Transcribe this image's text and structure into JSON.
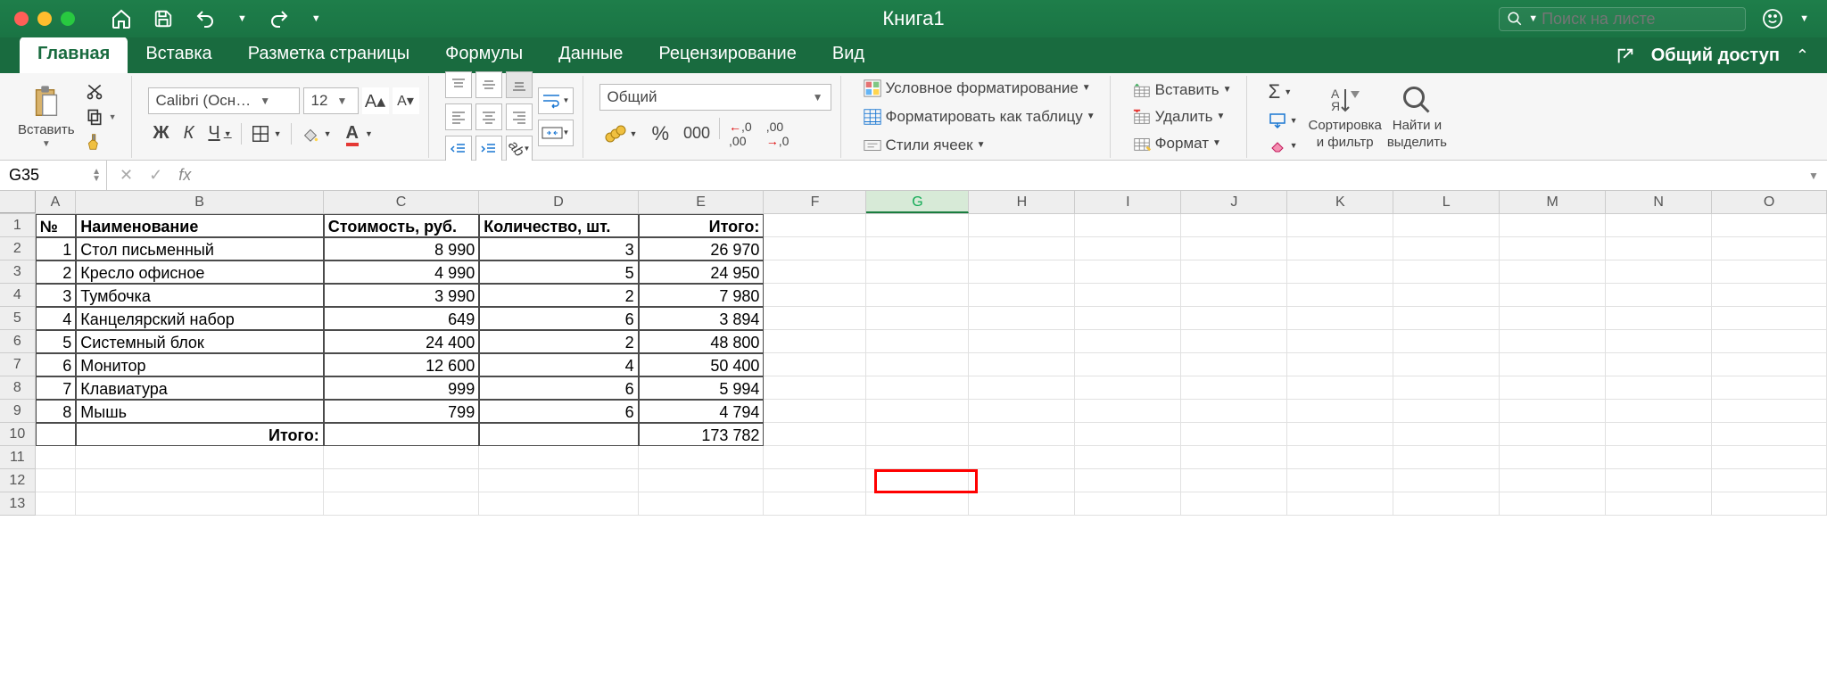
{
  "window": {
    "title": "Книга1"
  },
  "search": {
    "placeholder": "Поиск на листе"
  },
  "tabs": [
    "Главная",
    "Вставка",
    "Разметка страницы",
    "Формулы",
    "Данные",
    "Рецензирование",
    "Вид"
  ],
  "share": "Общий доступ",
  "ribbon": {
    "paste": "Вставить",
    "font_name": "Calibri (Осн…",
    "font_size": "12",
    "number_format": "Общий",
    "cond_fmt": "Условное форматирование",
    "fmt_table": "Форматировать как таблицу",
    "cell_styles": "Стили ячеек",
    "insert": "Вставить",
    "delete": "Удалить",
    "format": "Формат",
    "sort_filter_l1": "Сортировка",
    "sort_filter_l2": "и фильтр",
    "find_l1": "Найти и",
    "find_l2": "выделить"
  },
  "namebox": "G35",
  "columns": [
    "A",
    "B",
    "C",
    "D",
    "E",
    "F",
    "G",
    "H",
    "I",
    "J",
    "K",
    "L",
    "M",
    "N",
    "O"
  ],
  "header_row": {
    "a": "№",
    "b": "Наименование",
    "c": "Стоимость, руб.",
    "d": "Количество, шт.",
    "e": "Итого:"
  },
  "rows": [
    {
      "n": "1",
      "name": "Стол письменный",
      "cost": "8 990",
      "qty": "3",
      "total": "26 970"
    },
    {
      "n": "2",
      "name": "Кресло офисное",
      "cost": "4 990",
      "qty": "5",
      "total": "24 950"
    },
    {
      "n": "3",
      "name": "Тумбочка",
      "cost": "3 990",
      "qty": "2",
      "total": "7 980"
    },
    {
      "n": "4",
      "name": "Канцелярский набор",
      "cost": "649",
      "qty": "6",
      "total": "3 894"
    },
    {
      "n": "5",
      "name": "Системный блок",
      "cost": "24 400",
      "qty": "2",
      "total": "48 800"
    },
    {
      "n": "6",
      "name": "Монитор",
      "cost": "12 600",
      "qty": "4",
      "total": "50 400"
    },
    {
      "n": "7",
      "name": "Клавиатура",
      "cost": "999",
      "qty": "6",
      "total": "5 994"
    },
    {
      "n": "8",
      "name": "Мышь",
      "cost": "799",
      "qty": "6",
      "total": "4 794"
    }
  ],
  "footer": {
    "label": "Итого:",
    "grand_total": "173 782"
  },
  "chart_data": {
    "type": "table",
    "title": "Книга1",
    "columns": [
      "№",
      "Наименование",
      "Стоимость, руб.",
      "Количество, шт.",
      "Итого:"
    ],
    "data": [
      [
        1,
        "Стол письменный",
        8990,
        3,
        26970
      ],
      [
        2,
        "Кресло офисное",
        4990,
        5,
        24950
      ],
      [
        3,
        "Тумбочка",
        3990,
        2,
        7980
      ],
      [
        4,
        "Канцелярский набор",
        649,
        6,
        3894
      ],
      [
        5,
        "Системный блок",
        24400,
        2,
        48800
      ],
      [
        6,
        "Монитор",
        12600,
        4,
        50400
      ],
      [
        7,
        "Клавиатура",
        999,
        6,
        5994
      ],
      [
        8,
        "Мышь",
        799,
        6,
        4794
      ]
    ],
    "totals": {
      "Итого:": 173782
    }
  }
}
